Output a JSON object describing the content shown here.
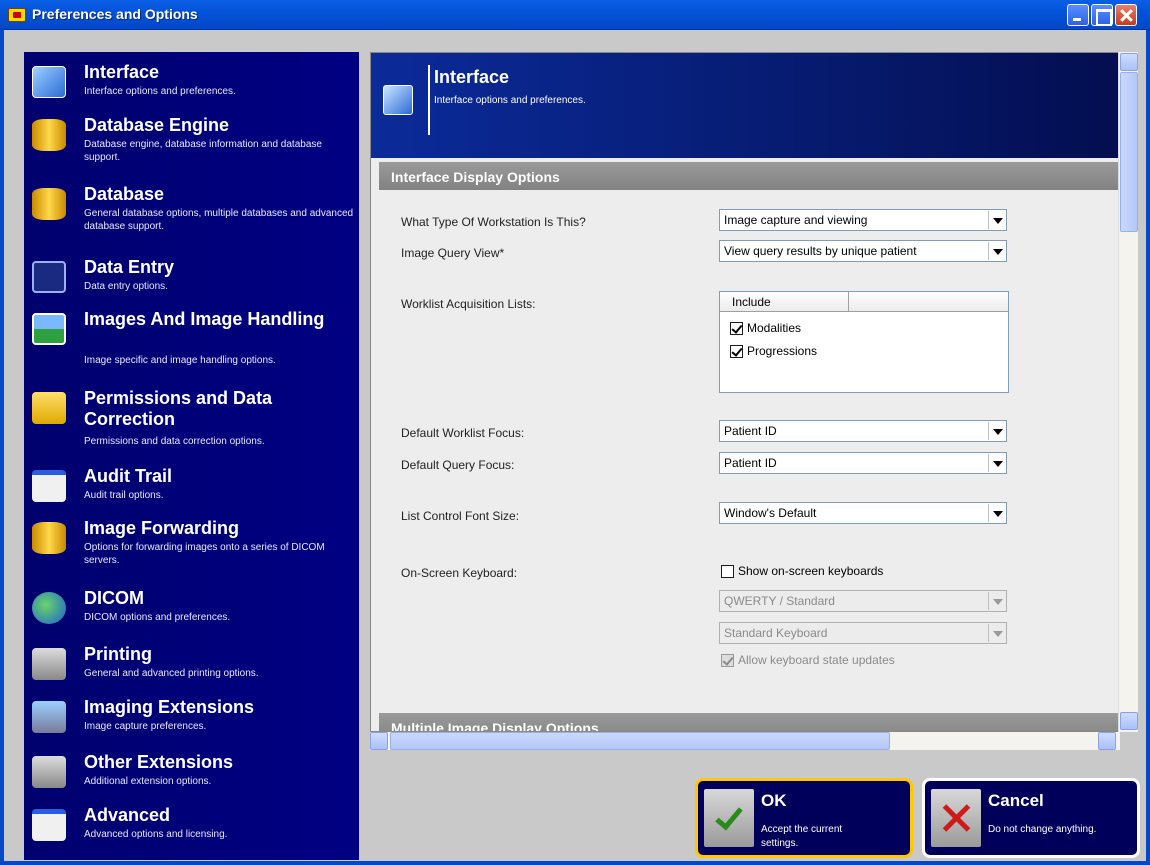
{
  "window": {
    "title": "Preferences and Options"
  },
  "sidebar": {
    "items": [
      {
        "label": "Interface",
        "desc": "Interface options and preferences.",
        "icon": "interface-icon"
      },
      {
        "label": "Database Engine",
        "desc": "Database engine, database information and database support.",
        "icon": "database-engine-icon"
      },
      {
        "label": "Database",
        "desc": "General database options, multiple databases and advanced database support.",
        "icon": "database-icon"
      },
      {
        "label": "Data Entry",
        "desc": "Data entry options.",
        "icon": "monitor-icon"
      },
      {
        "label": "Images And Image Handling",
        "desc": "Image specific and image handling options.",
        "icon": "image-icon"
      },
      {
        "label": "Permissions and Data Correction",
        "desc": "Permissions and data correction options.",
        "icon": "folder-icon"
      },
      {
        "label": "Audit Trail",
        "desc": "Audit trail options.",
        "icon": "window-icon"
      },
      {
        "label": "Image Forwarding",
        "desc": "Options for forwarding images onto a series of DICOM servers.",
        "icon": "forward-icon"
      },
      {
        "label": "DICOM",
        "desc": "DICOM options and preferences.",
        "icon": "globe-icon"
      },
      {
        "label": "Printing",
        "desc": "General and advanced printing options.",
        "icon": "printer-icon"
      },
      {
        "label": "Imaging Extensions",
        "desc": "Image capture preferences.",
        "icon": "extension-icon"
      },
      {
        "label": "Other Extensions",
        "desc": "Additional extension options.",
        "icon": "other-extension-icon"
      },
      {
        "label": "Advanced",
        "desc": "Advanced options and licensing.",
        "icon": "advanced-icon"
      }
    ]
  },
  "panel": {
    "title": "Interface",
    "desc": "Interface options and preferences.",
    "section1": "Interface Display Options",
    "section2": "Multiple Image Display Options",
    "workstation_label": "What Type Of Workstation Is This?",
    "workstation_value": "Image capture and viewing",
    "query_view_label": "Image Query View*",
    "query_view_value": "View query results by unique patient",
    "worklist_label": "Worklist Acquisition Lists:",
    "list_header": "Include",
    "list_items": [
      "Modalities",
      "Progressions"
    ],
    "worklist_focus_label": "Default Worklist Focus:",
    "worklist_focus_value": "Patient ID",
    "query_focus_label": "Default Query Focus:",
    "query_focus_value": "Patient ID",
    "font_size_label": "List Control Font Size:",
    "font_size_value": "Window's Default",
    "keyboard_label": "On-Screen Keyboard:",
    "keyboard_checkbox": "Show on-screen keyboards",
    "keyboard_layout": "QWERTY / Standard",
    "keyboard_type": "Standard Keyboard",
    "keyboard_state": "Allow keyboard state updates"
  },
  "buttons": {
    "ok_label": "OK",
    "ok_desc": "Accept the current settings.",
    "cancel_label": "Cancel",
    "cancel_desc": "Do not change anything."
  }
}
